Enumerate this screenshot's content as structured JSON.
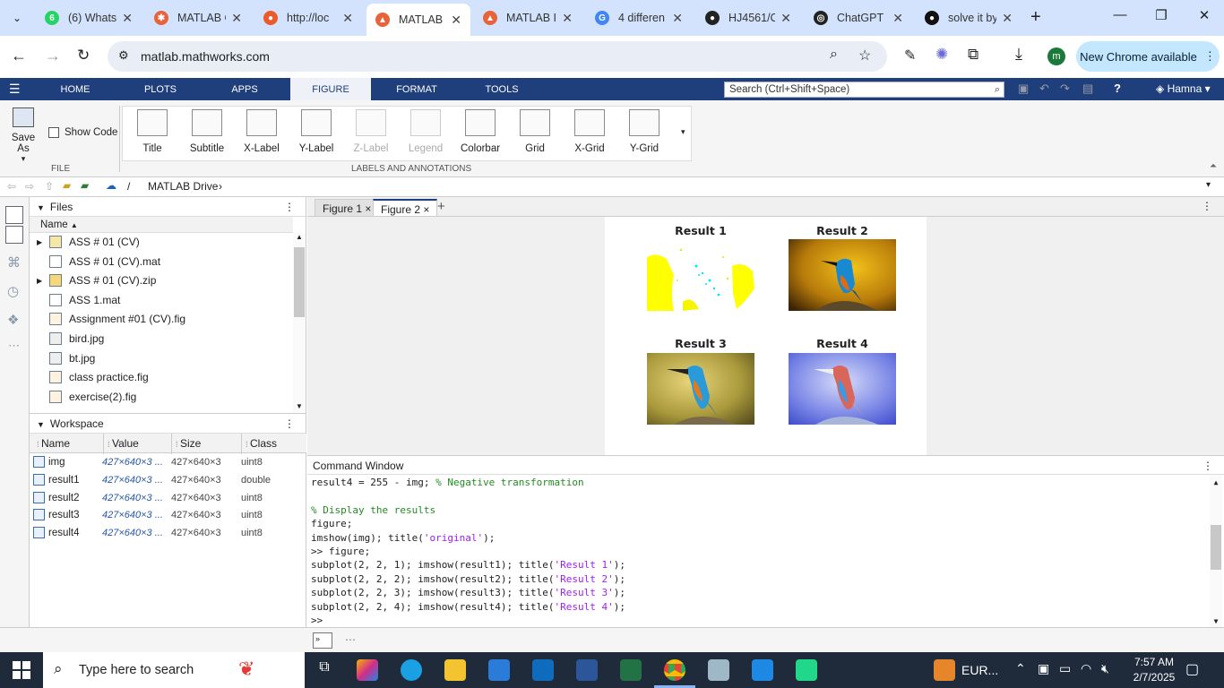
{
  "browser": {
    "tabs": [
      {
        "title": "(6) Whats",
        "color": "#25d366",
        "glyph": "6"
      },
      {
        "title": "MATLAB C",
        "color": "#e8623a",
        "glyph": "✱"
      },
      {
        "title": "http://loc",
        "color": "#ea5a2a",
        "glyph": "●"
      },
      {
        "title": "MATLAB",
        "color": "#e8623a",
        "glyph": "▲"
      },
      {
        "title": "MATLAB I",
        "color": "#e8623a",
        "glyph": "▲"
      },
      {
        "title": "4 differen",
        "color": "#4285f4",
        "glyph": "G"
      },
      {
        "title": "HJ4561/C",
        "color": "#222222",
        "glyph": "●"
      },
      {
        "title": "ChatGPT",
        "color": "#222222",
        "glyph": "◎"
      },
      {
        "title": "solve it by",
        "color": "#111111",
        "glyph": "●"
      }
    ],
    "url": "matlab.mathworks.com",
    "new_chrome": "New Chrome available",
    "profile_initial": "m"
  },
  "toolstrip": {
    "tabs": [
      "HOME",
      "PLOTS",
      "APPS",
      "FIGURE",
      "FORMAT",
      "TOOLS"
    ],
    "search_placeholder": "Search (Ctrl+Shift+Space)",
    "user": "Hamna",
    "save_as": "Save As",
    "show_code": "Show Code",
    "file_section": "FILE",
    "labels_section": "LABELS AND ANNOTATIONS",
    "buttons": [
      {
        "label": "Title",
        "enabled": true
      },
      {
        "label": "Subtitle",
        "enabled": true
      },
      {
        "label": "X-Label",
        "enabled": true
      },
      {
        "label": "Y-Label",
        "enabled": true
      },
      {
        "label": "Z-Label",
        "enabled": false
      },
      {
        "label": "Legend",
        "enabled": false
      },
      {
        "label": "Colorbar",
        "enabled": true
      },
      {
        "label": "Grid",
        "enabled": true
      },
      {
        "label": "X-Grid",
        "enabled": true
      },
      {
        "label": "Y-Grid",
        "enabled": true
      }
    ]
  },
  "pathbar": {
    "root": "/",
    "folder": "MATLAB Drive"
  },
  "files": {
    "title": "Files",
    "column": "Name",
    "items": [
      {
        "name": "ASS # 01 (CV)",
        "icon": "folder-icon",
        "expandable": true
      },
      {
        "name": "ASS # 01 (CV).mat",
        "icon": "mat-file-icon",
        "expandable": false
      },
      {
        "name": "ASS # 01 (CV).zip",
        "icon": "zip-file-icon",
        "expandable": true
      },
      {
        "name": "ASS 1.mat",
        "icon": "mat-file-icon",
        "expandable": false
      },
      {
        "name": "Assignment #01 (CV).fig",
        "icon": "fig-file-icon",
        "expandable": false
      },
      {
        "name": "bird.jpg",
        "icon": "image-file-icon",
        "expandable": false
      },
      {
        "name": "bt.jpg",
        "icon": "image-file-icon",
        "expandable": false
      },
      {
        "name": "class practice.fig",
        "icon": "fig-file-icon",
        "expandable": false
      },
      {
        "name": "exercise(2).fig",
        "icon": "fig-file-icon",
        "expandable": false
      }
    ]
  },
  "workspace": {
    "title": "Workspace",
    "columns": [
      "Name",
      "Value",
      "Size",
      "Class"
    ],
    "rows": [
      {
        "name": "img",
        "value": "427×640×3 ...",
        "size": "427×640×3",
        "class": "uint8"
      },
      {
        "name": "result1",
        "value": "427×640×3 ...",
        "size": "427×640×3",
        "class": "double"
      },
      {
        "name": "result2",
        "value": "427×640×3 ...",
        "size": "427×640×3",
        "class": "uint8"
      },
      {
        "name": "result3",
        "value": "427×640×3 ...",
        "size": "427×640×3",
        "class": "uint8"
      },
      {
        "name": "result4",
        "value": "427×640×3 ...",
        "size": "427×640×3",
        "class": "uint8"
      }
    ]
  },
  "figure": {
    "tabs": [
      "Figure 1",
      "Figure 2"
    ],
    "subplots": [
      "Result 1",
      "Result 2",
      "Result 3",
      "Result 4"
    ]
  },
  "command_window": {
    "title": "Command Window",
    "lines": [
      {
        "parts": [
          {
            "t": "result4 = 255 - img; ",
            "c": ""
          },
          {
            "t": "% Negative transformation",
            "c": "cmt"
          }
        ]
      },
      {
        "parts": [
          {
            "t": "",
            "c": ""
          }
        ]
      },
      {
        "parts": [
          {
            "t": "% Display the results",
            "c": "cmt"
          }
        ]
      },
      {
        "parts": [
          {
            "t": "figure;",
            "c": ""
          }
        ]
      },
      {
        "parts": [
          {
            "t": "imshow(img); title(",
            "c": ""
          },
          {
            "t": "'original'",
            "c": "str"
          },
          {
            "t": ");",
            "c": ""
          }
        ]
      },
      {
        "parts": [
          {
            "t": ">> figure;",
            "c": ""
          }
        ]
      },
      {
        "parts": [
          {
            "t": "subplot(2, 2, 1); imshow(result1); title(",
            "c": ""
          },
          {
            "t": "'Result 1'",
            "c": "str"
          },
          {
            "t": ");",
            "c": ""
          }
        ]
      },
      {
        "parts": [
          {
            "t": "subplot(2, 2, 2); imshow(result2); title(",
            "c": ""
          },
          {
            "t": "'Result 2'",
            "c": "str"
          },
          {
            "t": ");",
            "c": ""
          }
        ]
      },
      {
        "parts": [
          {
            "t": "subplot(2, 2, 3); imshow(result3); title(",
            "c": ""
          },
          {
            "t": "'Result 3'",
            "c": "str"
          },
          {
            "t": ");",
            "c": ""
          }
        ]
      },
      {
        "parts": [
          {
            "t": "subplot(2, 2, 4); imshow(result4); title(",
            "c": ""
          },
          {
            "t": "'Result 4'",
            "c": "str"
          },
          {
            "t": ");",
            "c": ""
          }
        ]
      },
      {
        "parts": [
          {
            "t": ">>",
            "c": ""
          }
        ]
      }
    ]
  },
  "taskbar": {
    "search_placeholder": "Type here to search",
    "lang": "EUR...",
    "time": "7:57 AM",
    "date": "2/7/2025"
  },
  "colors": {
    "matlab_blue": "#1e3f7b",
    "chrome_tabstrip": "#d3e3fd",
    "taskbar": "#1f2a3a"
  }
}
